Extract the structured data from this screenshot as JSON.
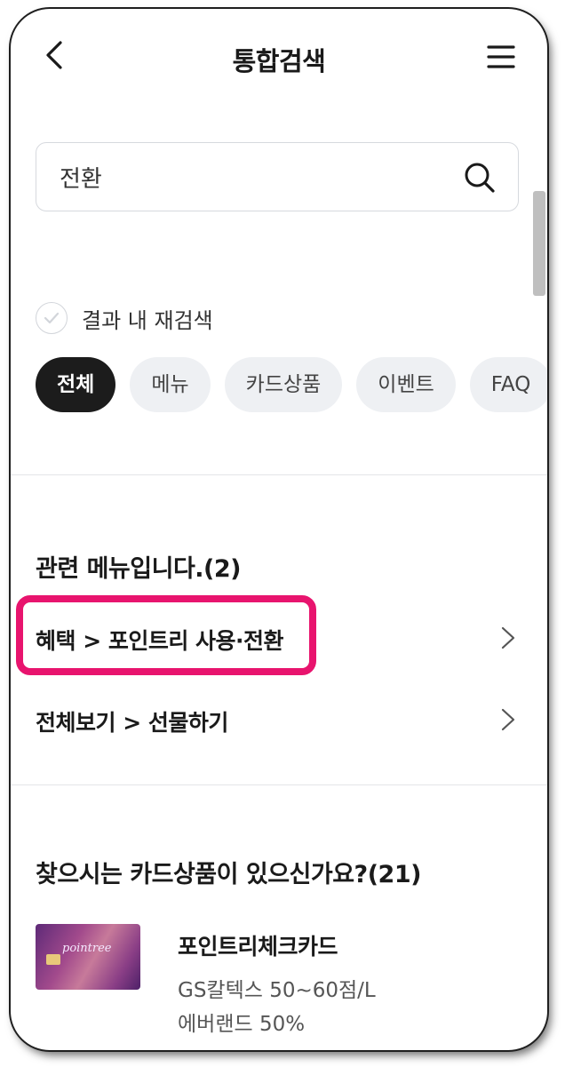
{
  "header": {
    "title": "통합검색",
    "back_icon": "chevron-left-icon",
    "menu_icon": "hamburger-menu-icon"
  },
  "search": {
    "value": "전환",
    "icon": "search-icon"
  },
  "research": {
    "label": "결과 내 재검색",
    "checked": false
  },
  "filters": {
    "chips": [
      "전체",
      "메뉴",
      "카드상품",
      "이벤트",
      "FAQ"
    ],
    "active": "전체"
  },
  "related_menus": {
    "title": "관련 메뉴입니다.(2)",
    "items": [
      {
        "label": "혜택 > 포인트리 사용·전환",
        "highlighted": true
      },
      {
        "label": "전체보기 > 선물하기",
        "highlighted": false
      }
    ]
  },
  "card_products": {
    "title": "찾으시는 카드상품이 있으신가요?(21)",
    "items": [
      {
        "brand": "pointree",
        "name": "포인트리체크카드",
        "desc_line1": "GS칼텍스 50~60점/L",
        "desc_line2": "에버랜드 50%"
      }
    ]
  },
  "colors": {
    "highlight": "#e8146e",
    "active_chip": "#1c1c1c",
    "chip_bg": "#eef0f3"
  }
}
